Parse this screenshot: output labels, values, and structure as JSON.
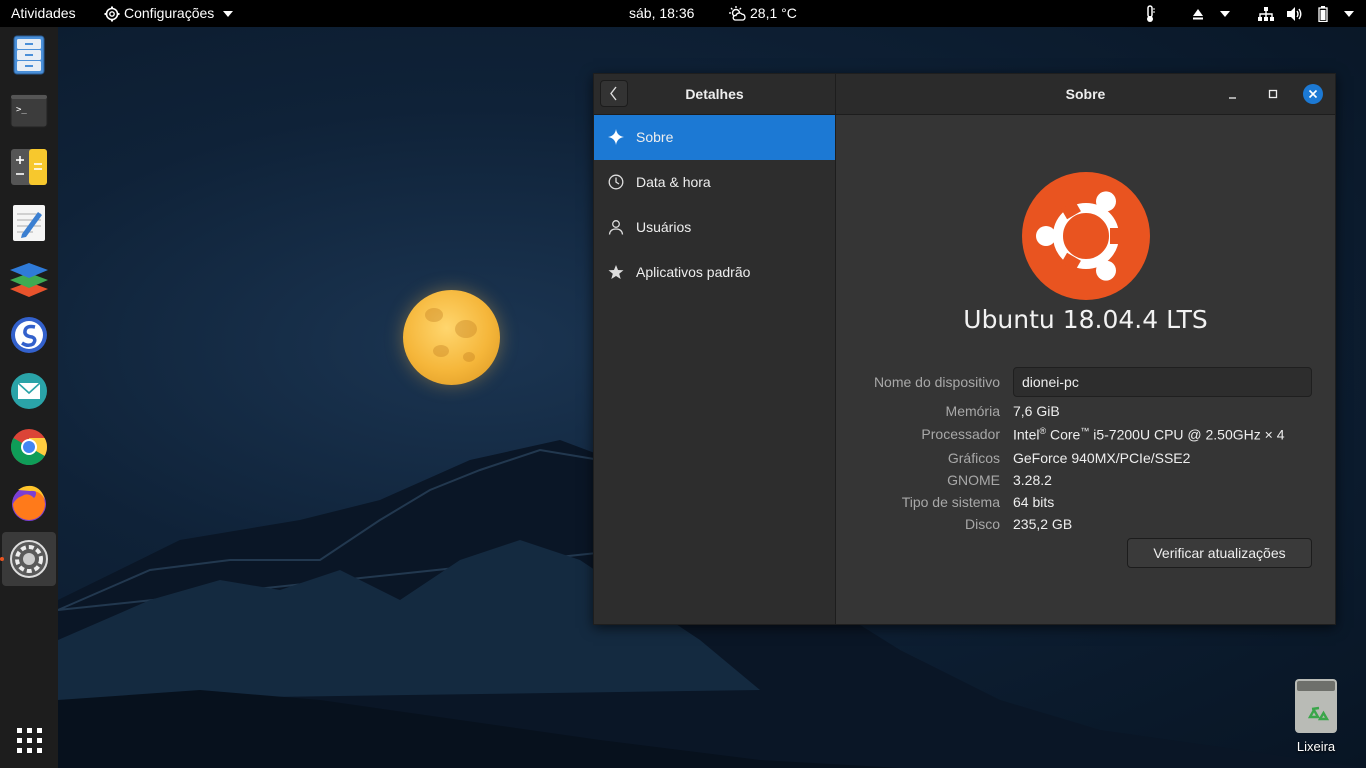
{
  "topbar": {
    "activities": "Atividades",
    "app_menu": "Configurações",
    "clock": "sáb, 18:36",
    "weather": "28,1 °C"
  },
  "dock": {
    "apps": [
      {
        "name": "files",
        "icon": "file-cabinet-icon"
      },
      {
        "name": "terminal",
        "icon": "terminal-icon",
        "glyph": ">_"
      },
      {
        "name": "calculator",
        "icon": "calculator-icon"
      },
      {
        "name": "text-editor",
        "icon": "text-editor-icon"
      },
      {
        "name": "layers-app",
        "icon": "layers-icon"
      },
      {
        "name": "simplenote",
        "icon": "simplenote-icon"
      },
      {
        "name": "mail",
        "icon": "mail-icon"
      },
      {
        "name": "chrome",
        "icon": "chrome-icon"
      },
      {
        "name": "firefox",
        "icon": "firefox-icon"
      },
      {
        "name": "settings",
        "icon": "settings-icon",
        "active": true
      }
    ]
  },
  "window": {
    "left_title": "Detalhes",
    "right_title": "Sobre",
    "sidebar": [
      {
        "label": "Sobre",
        "icon": "sparkle-icon",
        "selected": true
      },
      {
        "label": "Data & hora",
        "icon": "clock-icon"
      },
      {
        "label": "Usuários",
        "icon": "user-icon"
      },
      {
        "label": "Aplicativos padrão",
        "icon": "star-icon"
      }
    ],
    "about": {
      "os_name": "Ubuntu 18.04.4 LTS",
      "device_name_label": "Nome do dispositivo",
      "device_name_value": "dionei-pc",
      "memory_label": "Memória",
      "memory_value": "7,6 GiB",
      "processor_label": "Processador",
      "processor_value_prefix": "Intel",
      "processor_value_mid": "Core",
      "processor_value_suffix": "i5-7200U CPU @ 2.50GHz × 4",
      "graphics_label": "Gráficos",
      "graphics_value": "GeForce 940MX/PCIe/SSE2",
      "gnome_label": "GNOME",
      "gnome_value": "3.28.2",
      "system_type_label": "Tipo de sistema",
      "system_type_value": "64 bits",
      "disk_label": "Disco",
      "disk_value": "235,2 GB",
      "update_button": "Verificar atualizações"
    }
  },
  "desktop": {
    "trash_label": "Lixeira"
  },
  "colors": {
    "accent": "#1c79d4",
    "ubuntu_orange": "#e95420",
    "close_button": "#1c79d4"
  }
}
